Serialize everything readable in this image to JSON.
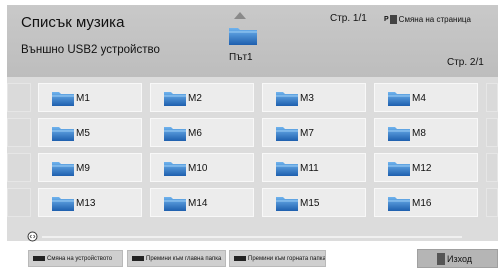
{
  "header": {
    "title": "Списък музика",
    "device": "Външно USB2 устройство",
    "page_top": "Стр. 1/1",
    "change_page_badge": "P",
    "change_page_label": "Смяна на страница",
    "page_right": "Стр. 2/1",
    "path": "Път1"
  },
  "folders": [
    "M1",
    "M2",
    "M3",
    "M4",
    "M5",
    "M6",
    "M7",
    "M8",
    "M9",
    "M10",
    "M11",
    "M12",
    "M13",
    "M14",
    "M15",
    "M16"
  ],
  "footer": {
    "change_device": "Смяна на устройството",
    "go_main_folder": "Премини към главна папка",
    "go_upper_folder": "Премини към горната папка",
    "exit": "Изход"
  },
  "colors": {
    "header_bg": "#c4c4c4",
    "grid_bg": "#dcdcdc",
    "tile_bg": "#ececec",
    "folder_icon": "#2a6fb8"
  }
}
